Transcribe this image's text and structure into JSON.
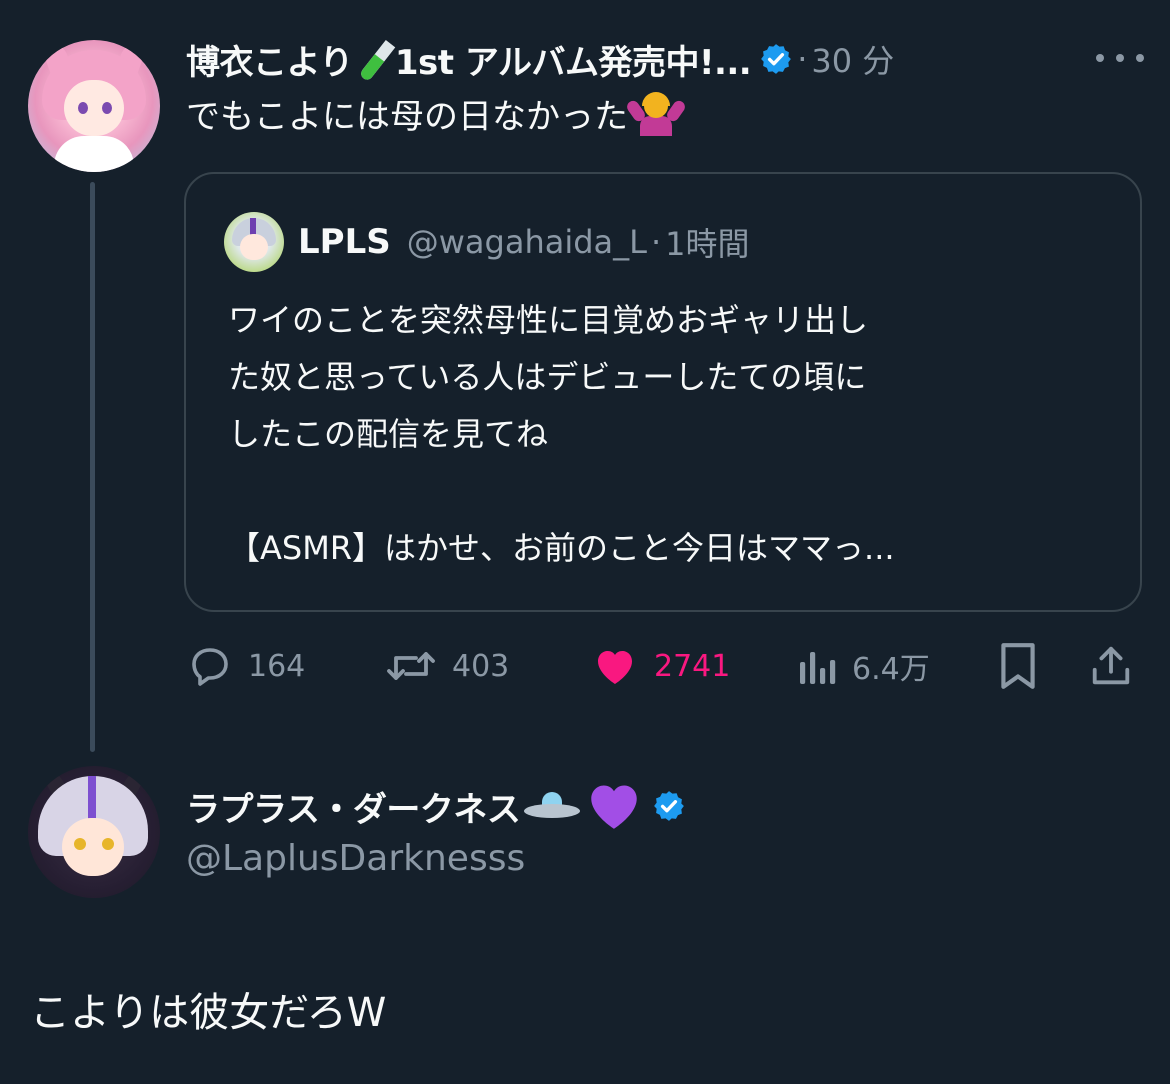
{
  "tweet": {
    "author_name": "博衣こより",
    "author_name_suffix": "1st アルバム発売中!...",
    "name_emoji": "test-tube-emoji",
    "verified": true,
    "meta_dot": "·",
    "time": "30 分",
    "text": "でもこよには母の日なかった",
    "text_emoji": "person-shrugging-emoji",
    "quote": {
      "name": "LPLS",
      "handle": "@wagahaida_L",
      "dot": "·",
      "time": "1時間",
      "lines": [
        "ワイのことを突然母性に目覚めおギャリ出し",
        "た奴と思っている人はデビューしたての頃に",
        "したこの配信を見てね",
        "",
        "【ASMR】はかせ、お前のこと今日はママっ..."
      ]
    },
    "actions": {
      "replies": "164",
      "retweets": "403",
      "likes": "2741",
      "views": "6.4万"
    },
    "colors": {
      "background": "#15202b",
      "text": "#f7f9f9",
      "muted": "#8b98a5",
      "like": "#f91880",
      "verified": "#1d9bf0",
      "border": "#38444d"
    }
  },
  "reply": {
    "author_name": "ラプラス・ダークネス",
    "name_emojis": [
      "flying-saucer-emoji",
      "purple-heart-emoji"
    ],
    "verified": true,
    "handle": "@LaplusDarknesss",
    "text": "こよりは彼女だろW"
  }
}
